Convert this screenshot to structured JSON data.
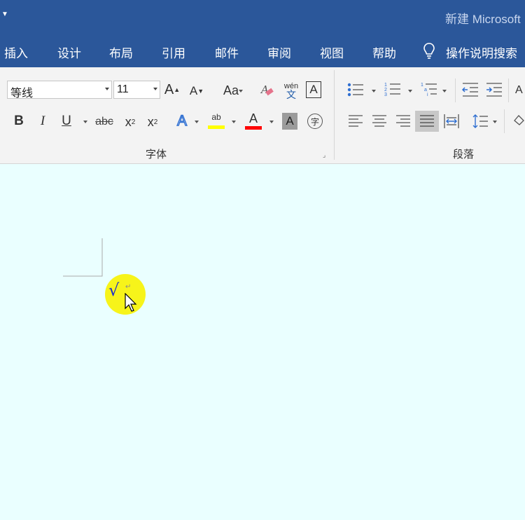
{
  "window": {
    "title": "新建 Microsoft"
  },
  "tabs": [
    "插入",
    "设计",
    "布局",
    "引用",
    "邮件",
    "审阅",
    "视图",
    "帮助"
  ],
  "tell_me": "操作说明搜索",
  "font_group": {
    "font_name": "等线",
    "font_size": "11",
    "case_label": "Aa",
    "phonetic_top": "wén",
    "phonetic_bottom": "文",
    "border_char": "A",
    "bold": "B",
    "italic": "I",
    "underline": "U",
    "strike": "abc",
    "subscript_base": "x",
    "subscript_mark": "2",
    "superscript_base": "x",
    "superscript_mark": "2",
    "effects": "A",
    "highlight_label": "ab",
    "font_color_label": "A",
    "shading_label": "A",
    "enclose_label": "字",
    "label": "字体",
    "highlight_color": "#ffff00",
    "font_color": "#ff0000"
  },
  "paragraph_group": {
    "label": "段落"
  },
  "document": {
    "inserted_text": "√",
    "paragraph_mark": "↵"
  }
}
